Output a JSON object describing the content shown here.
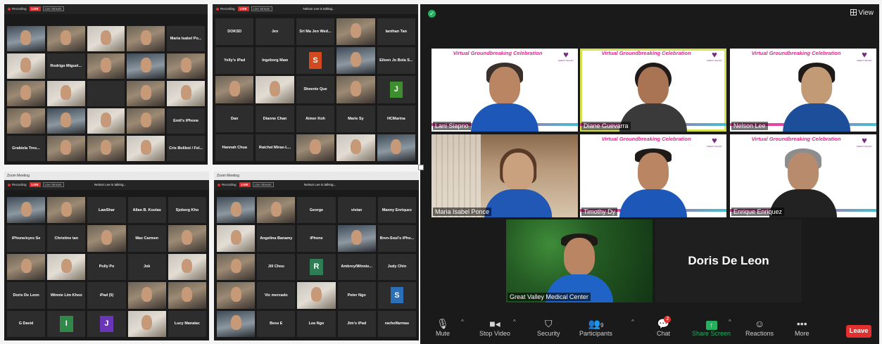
{
  "window_a": {
    "title": "Recording",
    "record_label": "Recording",
    "live_label": "LIVE",
    "sub_label": "Live Stream",
    "speaker": "",
    "tiles": [
      {
        "name": "",
        "kind": "video"
      },
      {
        "name": "",
        "kind": "video"
      },
      {
        "name": "",
        "kind": "video"
      },
      {
        "name": "",
        "kind": "video"
      },
      {
        "name": "Maria Isabel Po...",
        "kind": "name"
      },
      {
        "name": "",
        "kind": "video"
      },
      {
        "name": "Rodrigo Miguel...",
        "kind": "name"
      },
      {
        "name": "",
        "kind": "video"
      },
      {
        "name": "",
        "kind": "video"
      },
      {
        "name": "",
        "kind": "video"
      },
      {
        "name": "",
        "kind": "video"
      },
      {
        "name": "",
        "kind": "video"
      },
      {
        "name": "",
        "kind": "blank"
      },
      {
        "name": "",
        "kind": "video"
      },
      {
        "name": "",
        "kind": "video"
      },
      {
        "name": "",
        "kind": "video"
      },
      {
        "name": "",
        "kind": "video"
      },
      {
        "name": "",
        "kind": "video"
      },
      {
        "name": "",
        "kind": "video"
      },
      {
        "name": "Emil's iPhone",
        "kind": "name"
      },
      {
        "name": "Grabiela Tres...",
        "kind": "name"
      },
      {
        "name": "",
        "kind": "video"
      },
      {
        "name": "",
        "kind": "video"
      },
      {
        "name": "",
        "kind": "video"
      },
      {
        "name": "Cris Bolibol / Fel...",
        "kind": "name"
      }
    ]
  },
  "window_b": {
    "title": "Recording",
    "record_label": "Recording",
    "live_label": "LIVE",
    "sub_label": "Live Stream",
    "speaker": "Nelson Lee is talking...",
    "tiles": [
      {
        "name": "DOKSD",
        "kind": "name"
      },
      {
        "name": "Jen",
        "kind": "name"
      },
      {
        "name": "Sri Ma Jen Wed...",
        "kind": "name"
      },
      {
        "name": "",
        "kind": "video"
      },
      {
        "name": "Ianthan Tan",
        "kind": "name"
      },
      {
        "name": "Yelly's iPad",
        "kind": "name"
      },
      {
        "name": "Ingeborg Maw",
        "kind": "name"
      },
      {
        "name": "S",
        "kind": "avatar",
        "color": "#d14a1f"
      },
      {
        "name": "",
        "kind": "video"
      },
      {
        "name": "Eileen Jo Bola S...",
        "kind": "name"
      },
      {
        "name": "",
        "kind": "video"
      },
      {
        "name": "",
        "kind": "video"
      },
      {
        "name": "Sheenie Que",
        "kind": "name"
      },
      {
        "name": "",
        "kind": "video"
      },
      {
        "name": "J",
        "kind": "avatar",
        "color": "#3c8f2c"
      },
      {
        "name": "Dan",
        "kind": "name"
      },
      {
        "name": "Dianne Chan",
        "kind": "name"
      },
      {
        "name": "Aimer Koh",
        "kind": "name"
      },
      {
        "name": "Marie Sy",
        "kind": "name"
      },
      {
        "name": "HCMarina",
        "kind": "name"
      },
      {
        "name": "Hannah Chua",
        "kind": "name"
      },
      {
        "name": "Raichel Mirae-L...",
        "kind": "name"
      },
      {
        "name": "",
        "kind": "video"
      },
      {
        "name": "",
        "kind": "video"
      },
      {
        "name": "",
        "kind": "video"
      }
    ]
  },
  "window_c": {
    "title": "Zoom Meeting",
    "record_label": "Recording",
    "live_label": "LIVE",
    "sub_label": "Live Stream",
    "speaker": "Nelson Lee is talking...",
    "tiles": [
      {
        "name": "",
        "kind": "video"
      },
      {
        "name": "",
        "kind": "video"
      },
      {
        "name": "LawShar",
        "kind": "name"
      },
      {
        "name": "Allan B. Koolas",
        "kind": "name"
      },
      {
        "name": "Sjoberg Kho",
        "kind": "name"
      },
      {
        "name": "iPhone/eyes Se",
        "kind": "name"
      },
      {
        "name": "Christine tan",
        "kind": "name"
      },
      {
        "name": "",
        "kind": "video"
      },
      {
        "name": "Max Carmen",
        "kind": "name"
      },
      {
        "name": "",
        "kind": "video"
      },
      {
        "name": "",
        "kind": "video"
      },
      {
        "name": "",
        "kind": "video"
      },
      {
        "name": "Polly Po",
        "kind": "name"
      },
      {
        "name": "Jok",
        "kind": "name"
      },
      {
        "name": "",
        "kind": "video"
      },
      {
        "name": "Doris De Leon",
        "kind": "name"
      },
      {
        "name": "Winnie Lim Khoo",
        "kind": "name"
      },
      {
        "name": "iPad (5)",
        "kind": "name"
      },
      {
        "name": "",
        "kind": "video"
      },
      {
        "name": "",
        "kind": "video"
      },
      {
        "name": "G David",
        "kind": "name"
      },
      {
        "name": "I",
        "kind": "avatar",
        "color": "#2f8a4a"
      },
      {
        "name": "J",
        "kind": "avatar",
        "color": "#6a36b8"
      },
      {
        "name": "",
        "kind": "video"
      },
      {
        "name": "Lucy Manalac",
        "kind": "name"
      }
    ]
  },
  "window_d": {
    "title": "Zoom Meeting",
    "record_label": "Recording",
    "live_label": "LIVE",
    "sub_label": "Live Stream",
    "speaker": "Nelson Lee is talking...",
    "tiles": [
      {
        "name": "",
        "kind": "video"
      },
      {
        "name": "",
        "kind": "video"
      },
      {
        "name": "George",
        "kind": "name"
      },
      {
        "name": "vivian",
        "kind": "name"
      },
      {
        "name": "Manny Enriquez",
        "kind": "name"
      },
      {
        "name": "",
        "kind": "video"
      },
      {
        "name": "Angelina Banamy",
        "kind": "name"
      },
      {
        "name": "iPhone",
        "kind": "name"
      },
      {
        "name": "",
        "kind": "video"
      },
      {
        "name": "Bren-Soul's iPho...",
        "kind": "name"
      },
      {
        "name": "",
        "kind": "video"
      },
      {
        "name": "Jill Chou",
        "kind": "name"
      },
      {
        "name": "R",
        "kind": "avatar",
        "color": "#2f7d54"
      },
      {
        "name": "Ambrey/Winnie...",
        "kind": "name"
      },
      {
        "name": "Judy Chin",
        "kind": "name"
      },
      {
        "name": "",
        "kind": "video"
      },
      {
        "name": "Vic mercado",
        "kind": "name"
      },
      {
        "name": "",
        "kind": "video"
      },
      {
        "name": "Peter Ngo",
        "kind": "name"
      },
      {
        "name": "S",
        "kind": "avatar",
        "color": "#2a6fb8"
      },
      {
        "name": "",
        "kind": "video"
      },
      {
        "name": "Bess E",
        "kind": "name"
      },
      {
        "name": "Lea Ngo",
        "kind": "name"
      },
      {
        "name": "Jim's iPad",
        "kind": "name"
      },
      {
        "name": "rachelfarmas",
        "kind": "name"
      }
    ]
  },
  "main": {
    "view_label": "View",
    "banner_text": "Virtual Groundbreaking Celebration",
    "logo_caption": "GREAT VALLEY",
    "videos": [
      {
        "name": "Lani Siapno",
        "banner": true
      },
      {
        "name": "Diane Guevarra",
        "banner": true,
        "active": true
      },
      {
        "name": "Nelson Lee",
        "banner": true
      },
      {
        "name": "Maria Isabel Ponce",
        "banner": false
      },
      {
        "name": "Timothy Dy",
        "banner": true
      },
      {
        "name": "Enrique Enriquez",
        "banner": true
      },
      {
        "name": "Great Valley Medical Center",
        "banner": false
      }
    ],
    "name_only_tile": "Doris De Leon",
    "toolbar": {
      "mute": "Mute",
      "stop_video": "Stop Video",
      "security": "Security",
      "participants": "Participants",
      "participants_count": "9",
      "chat": "Chat",
      "chat_badge": "2",
      "share_screen": "Share Screen",
      "reactions": "Reactions",
      "more": "More",
      "leave": "Leave"
    },
    "colors": {
      "accent_green": "#23b160",
      "leave_red": "#e2302e",
      "banner_pink": "#e3258e",
      "logo_purple": "#7c2a86",
      "active_border": "#d7e34a"
    }
  }
}
